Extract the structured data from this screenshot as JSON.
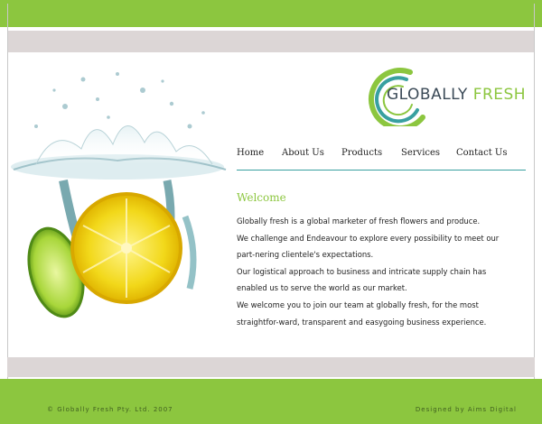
{
  "logo": {
    "word1": "GLOBALLY",
    "word2": "FRESH"
  },
  "nav": {
    "items": [
      "Home",
      "About Us",
      "Products",
      "Services",
      "Contact Us"
    ]
  },
  "main": {
    "heading": "Welcome",
    "paragraphs": [
      "Globally fresh is a global marketer of fresh flowers and produce.",
      "We challenge and Endeavour to explore every possibility to meet our part-nering clientele's expectations.",
      "Our logistical approach to business and intricate supply chain has enabled us to serve the world as our market.",
      "We welcome you to join our team at globally fresh, for the most straightfor-ward, transparent and easygoing business experience."
    ]
  },
  "footer": {
    "copyright": "© Globally Fresh Pty. Ltd. 2007",
    "credit": "Designed by Aims Digital"
  },
  "colors": {
    "brand_green": "#8cc63f",
    "teal": "#38a0a0",
    "band_gray": "#dcd6d6",
    "logo_gray": "#3b4a57"
  }
}
